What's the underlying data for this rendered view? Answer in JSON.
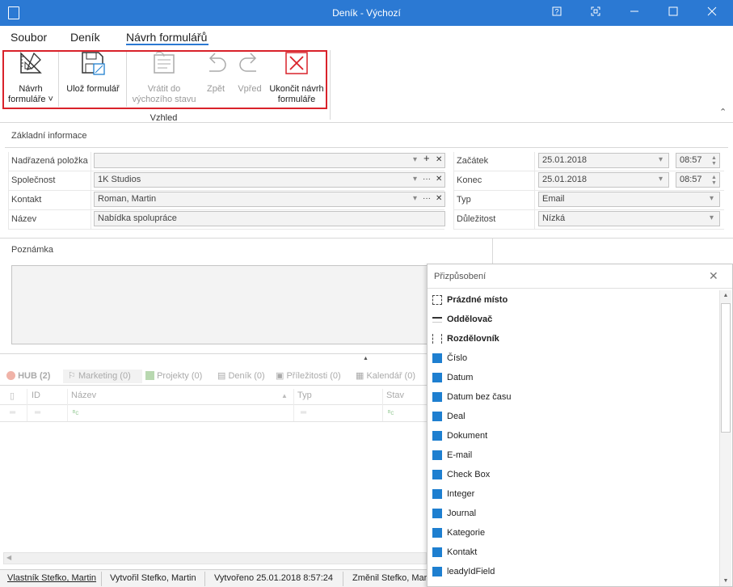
{
  "window": {
    "title": "Deník - Výchozí"
  },
  "menu": {
    "items": [
      "Soubor",
      "Deník",
      "Návrh formulářů"
    ]
  },
  "ribbon": {
    "buttons": [
      {
        "label1": "Návrh",
        "label2": "formuláře ˅"
      },
      {
        "label1": "Ulož formulář",
        "label2": ""
      },
      {
        "label1": "Vrátit do",
        "label2": "výchozího stavu"
      },
      {
        "label1": "Zpět",
        "label2": ""
      },
      {
        "label1": "Vpřed",
        "label2": ""
      },
      {
        "label1": "Ukončit návrh",
        "label2": "formuláře"
      }
    ],
    "group_label": "Vzhled"
  },
  "basic": {
    "title": "Základní informace",
    "left": [
      {
        "label": "Nadřazená položka",
        "value": ""
      },
      {
        "label": "Společnost",
        "value": "1K Studios"
      },
      {
        "label": "Kontakt",
        "value": "Roman, Martin"
      },
      {
        "label": "Název",
        "value": "Nabídka spolupráce"
      }
    ],
    "right": [
      {
        "label": "Začátek",
        "value": "25.01.2018",
        "time": "08:57"
      },
      {
        "label": "Konec",
        "value": "25.01.2018",
        "time": "08:57"
      },
      {
        "label": "Typ",
        "value": "Email"
      },
      {
        "label": "Důležitost",
        "value": "Nízká"
      }
    ]
  },
  "note": {
    "title": "Poznámka"
  },
  "tabs": [
    "HUB (2)",
    "Marketing (0)",
    "Projekty (0)",
    "Deník (0)",
    "Příležitosti (0)",
    "Kalendář (0)"
  ],
  "grid": {
    "headers": [
      "ID",
      "Název",
      "Typ",
      "Stav"
    ]
  },
  "status": {
    "owner": "Vlastník Stefko, Martin",
    "created_by": "Vytvořil Stefko, Martin",
    "created": "Vytvořeno 25.01.2018 8:57:24",
    "changed_by": "Změnil Stefko, Martin"
  },
  "customize": {
    "title": "Přizpůsobení",
    "items": [
      {
        "label": "Prázdné místo",
        "kind": "empty"
      },
      {
        "label": "Oddělovač",
        "kind": "separator"
      },
      {
        "label": "Rozdělovník",
        "kind": "splitter"
      },
      {
        "label": "Číslo",
        "kind": "field"
      },
      {
        "label": "Datum",
        "kind": "field"
      },
      {
        "label": "Datum bez času",
        "kind": "field"
      },
      {
        "label": "Deal",
        "kind": "field"
      },
      {
        "label": "Dokument",
        "kind": "field"
      },
      {
        "label": "E-mail",
        "kind": "field"
      },
      {
        "label": "Check Box",
        "kind": "field"
      },
      {
        "label": "Integer",
        "kind": "field"
      },
      {
        "label": "Journal",
        "kind": "field"
      },
      {
        "label": "Kategorie",
        "kind": "field"
      },
      {
        "label": "Kontakt",
        "kind": "field"
      },
      {
        "label": "leadyIdField",
        "kind": "field"
      }
    ]
  },
  "colors": {
    "titlebar": "#2b79d3",
    "accent": "#1e7fd0",
    "highlight": "#d9222a"
  }
}
